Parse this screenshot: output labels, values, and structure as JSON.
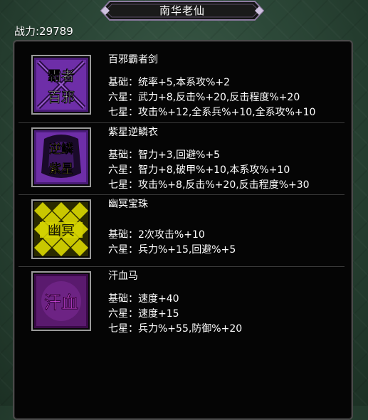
{
  "header": {
    "title": "南华老仙"
  },
  "power": {
    "label": "战力:29789"
  },
  "items": [
    {
      "icon": "sword-icon",
      "icon_text": [
        "霸者",
        "百邪"
      ],
      "name": "百邪霸者剑",
      "stats": [
        "基础：统率+5,本系攻%+2",
        "六星：武力+8,反击%+20,反击程度%+20",
        "七星：攻击%+12,全系兵%+10,全系攻%+10"
      ]
    },
    {
      "icon": "armor-icon",
      "icon_text": [
        "逆鳞",
        "紫星"
      ],
      "name": "紫星逆鳞衣",
      "stats": [
        "基础：智力+3,回避%+5",
        "六星：智力+8,破甲%+10,本系攻%+10",
        "七星：攻击%+8,反击%+20,反击程度%+30"
      ]
    },
    {
      "icon": "pearl-icon",
      "icon_text": [
        "幽冥"
      ],
      "name": "幽冥宝珠",
      "stats": [
        "基础：2次攻击%+10",
        "六星：兵力%+15,回避%+5"
      ]
    },
    {
      "icon": "horse-icon",
      "icon_text": [
        "汗血"
      ],
      "name": "汗血马",
      "stats": [
        "基础：速度+40",
        "六星：速度+15",
        "七星：兵力%+55,防御%+20"
      ]
    }
  ],
  "colors": {
    "purple": "#6a2d9e",
    "yellow": "#c9c700",
    "magenta": "#b02ed0"
  }
}
